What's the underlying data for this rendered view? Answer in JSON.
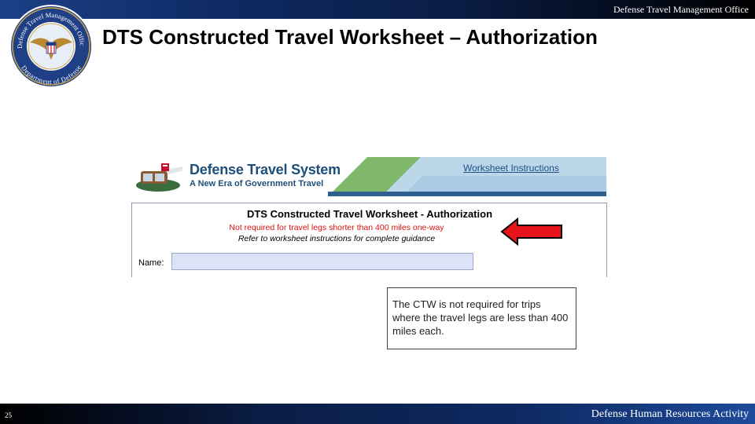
{
  "header": {
    "org_label": "Defense Travel Management Office",
    "seal_top_text": "Defense Travel Management Office",
    "seal_bottom_text": "Department of Defense",
    "title": "DTS Constructed Travel Worksheet – Authorization"
  },
  "banner": {
    "system_name": "Defense Travel System",
    "tagline": "A New Era of Government Travel",
    "instructions_link": "Worksheet Instructions",
    "colors": {
      "green": "#7fb86a",
      "blue": "#bcd7ea",
      "text": "#1e4e7a"
    }
  },
  "worksheet": {
    "heading": "DTS Constructed Travel Worksheet - Authorization",
    "notice": "Not required for travel legs shorter than 400 miles one-way",
    "guidance": "Refer to worksheet instructions for complete guidance",
    "name_label": "Name:",
    "name_value": "",
    "name_placeholder": ""
  },
  "callout": {
    "text": "The CTW is not required for trips where the travel legs are less than 400 miles each."
  },
  "footer": {
    "page_number": "25",
    "label": "Defense Human Resources Activity"
  },
  "icons": {
    "seal": "dod-seal-icon",
    "dts_logo": "dts-logo-icon",
    "pointer": "red-arrow-icon"
  },
  "colors": {
    "arrow_red": "#e8141b",
    "notice_red": "#e01010",
    "name_field": "#dde3f7"
  }
}
